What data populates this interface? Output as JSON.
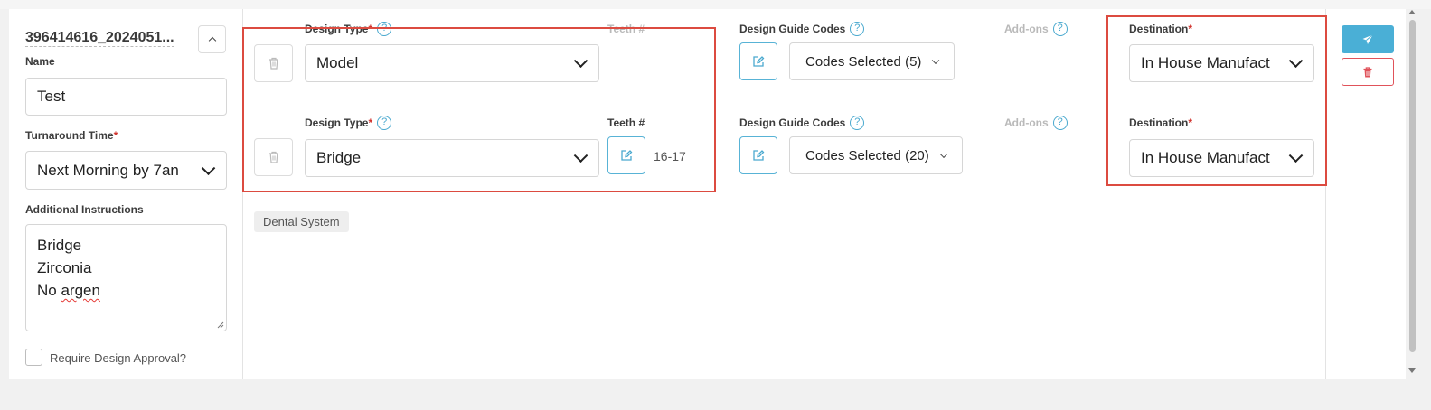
{
  "order": {
    "id": "396414616_2024051...",
    "collapse_icon": "chevron-up-icon",
    "name_label": "Name",
    "name_value": "Test",
    "turnaround_label": "Turnaround Time",
    "turnaround_value": "Next Morning by 7an",
    "instructions_label": "Additional Instructions",
    "instructions_lines": [
      "Bridge",
      "Zirconia",
      "No argen"
    ],
    "require_approval_label": "Require Design Approval?",
    "require_approval_checked": false
  },
  "labels": {
    "design_type": "Design Type",
    "teeth": "Teeth #",
    "design_guide_codes": "Design Guide Codes",
    "addons": "Add-ons",
    "destination": "Destination",
    "required_mark": "*",
    "help_glyph": "?"
  },
  "rows": [
    {
      "design_type": "Model",
      "teeth": "",
      "codes": "Codes Selected (5)",
      "destination": "In House Manufact"
    },
    {
      "design_type": "Bridge",
      "teeth": "16-17",
      "codes": "Codes Selected (20)",
      "destination": "In House Manufact"
    }
  ],
  "system_tag": "Dental System",
  "actions": {
    "send_icon": "paper-plane-icon",
    "delete_icon": "trash-icon"
  },
  "colors": {
    "accent": "#4aafd6",
    "danger": "#e0525a",
    "highlight_box": "#dc4b40",
    "required": "#d0302a"
  }
}
